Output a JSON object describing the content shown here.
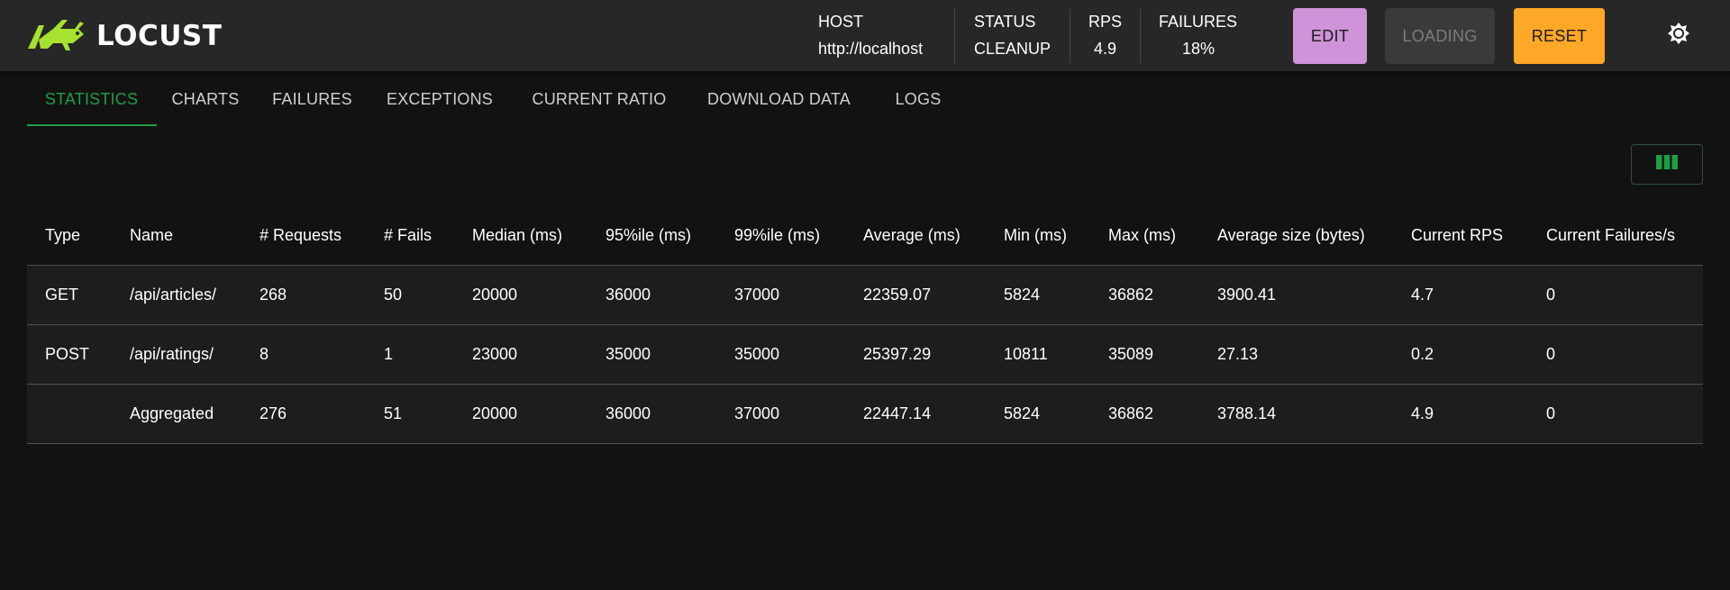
{
  "app": {
    "name": "LOCUST",
    "brand_color": "#a6e22e"
  },
  "header": {
    "host": {
      "label": "HOST",
      "value": "http://localhost"
    },
    "status": {
      "label": "STATUS",
      "value": "CLEANUP"
    },
    "rps": {
      "label": "RPS",
      "value": "4.9"
    },
    "failures": {
      "label": "FAILURES",
      "value": "18%"
    },
    "buttons": {
      "edit": "EDIT",
      "loading": "LOADING",
      "reset": "RESET"
    },
    "theme_icon": "brightness-icon"
  },
  "tabs": [
    {
      "label": "STATISTICS",
      "active": true
    },
    {
      "label": "CHARTS"
    },
    {
      "label": "FAILURES"
    },
    {
      "label": "EXCEPTIONS"
    },
    {
      "label": "CURRENT RATIO"
    },
    {
      "label": "DOWNLOAD DATA"
    },
    {
      "label": "LOGS"
    }
  ],
  "toolbar": {
    "columns_icon": "view-columns-icon"
  },
  "table": {
    "headers": [
      "Type",
      "Name",
      "# Requests",
      "# Fails",
      "Median (ms)",
      "95%ile (ms)",
      "99%ile (ms)",
      "Average (ms)",
      "Min (ms)",
      "Max (ms)",
      "Average size (bytes)",
      "Current RPS",
      "Current Failures/s"
    ],
    "rows": [
      [
        "GET",
        "/api/articles/",
        "268",
        "50",
        "20000",
        "36000",
        "37000",
        "22359.07",
        "5824",
        "36862",
        "3900.41",
        "4.7",
        "0"
      ],
      [
        "POST",
        "/api/ratings/",
        "8",
        "1",
        "23000",
        "35000",
        "35000",
        "25397.29",
        "10811",
        "35089",
        "27.13",
        "0.2",
        "0"
      ],
      [
        "",
        "Aggregated",
        "276",
        "51",
        "20000",
        "36000",
        "37000",
        "22447.14",
        "5824",
        "36862",
        "3788.14",
        "4.9",
        "0"
      ]
    ]
  },
  "colors": {
    "accent_green": "#1e9e45",
    "edit_button": "#ce93d8",
    "reset_button": "#ffa726",
    "header_bg": "#272727",
    "page_bg": "#121212"
  }
}
